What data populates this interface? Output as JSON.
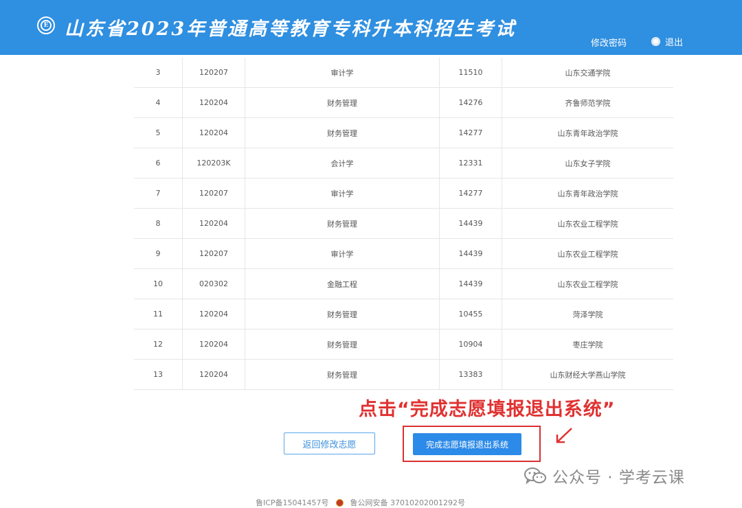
{
  "header": {
    "logo_glyph": "E",
    "title": "山东省2023年普通高等教育专科升本科招生考试",
    "change_password": "修改密码",
    "logout": "退出",
    "bg_color": "#2f8fe0"
  },
  "table": {
    "rows": [
      {
        "idx": "3",
        "code": "120207",
        "major": "审计学",
        "school_code": "11510",
        "school": "山东交通学院"
      },
      {
        "idx": "4",
        "code": "120204",
        "major": "财务管理",
        "school_code": "14276",
        "school": "齐鲁师范学院"
      },
      {
        "idx": "5",
        "code": "120204",
        "major": "财务管理",
        "school_code": "14277",
        "school": "山东青年政治学院"
      },
      {
        "idx": "6",
        "code": "120203K",
        "major": "会计学",
        "school_code": "12331",
        "school": "山东女子学院"
      },
      {
        "idx": "7",
        "code": "120207",
        "major": "审计学",
        "school_code": "14277",
        "school": "山东青年政治学院"
      },
      {
        "idx": "8",
        "code": "120204",
        "major": "财务管理",
        "school_code": "14439",
        "school": "山东农业工程学院"
      },
      {
        "idx": "9",
        "code": "120207",
        "major": "审计学",
        "school_code": "14439",
        "school": "山东农业工程学院"
      },
      {
        "idx": "10",
        "code": "020302",
        "major": "金融工程",
        "school_code": "14439",
        "school": "山东农业工程学院"
      },
      {
        "idx": "11",
        "code": "120204",
        "major": "财务管理",
        "school_code": "10455",
        "school": "菏泽学院"
      },
      {
        "idx": "12",
        "code": "120204",
        "major": "财务管理",
        "school_code": "10904",
        "school": "枣庄学院"
      },
      {
        "idx": "13",
        "code": "120204",
        "major": "财务管理",
        "school_code": "13383",
        "school": "山东财经大学燕山学院"
      }
    ]
  },
  "annotation": {
    "text": "点击“完成志愿填报退出系统”",
    "color": "#e03131"
  },
  "actions": {
    "back_label": "返回修改志愿",
    "finish_label": "完成志愿填报退出系统"
  },
  "watermark": {
    "text": "公众号 · 学考云课",
    "icon": "wechat-icon"
  },
  "footer": {
    "icp": "鲁ICP备15041457号",
    "police": "鲁公网安备 37010202001292号"
  }
}
